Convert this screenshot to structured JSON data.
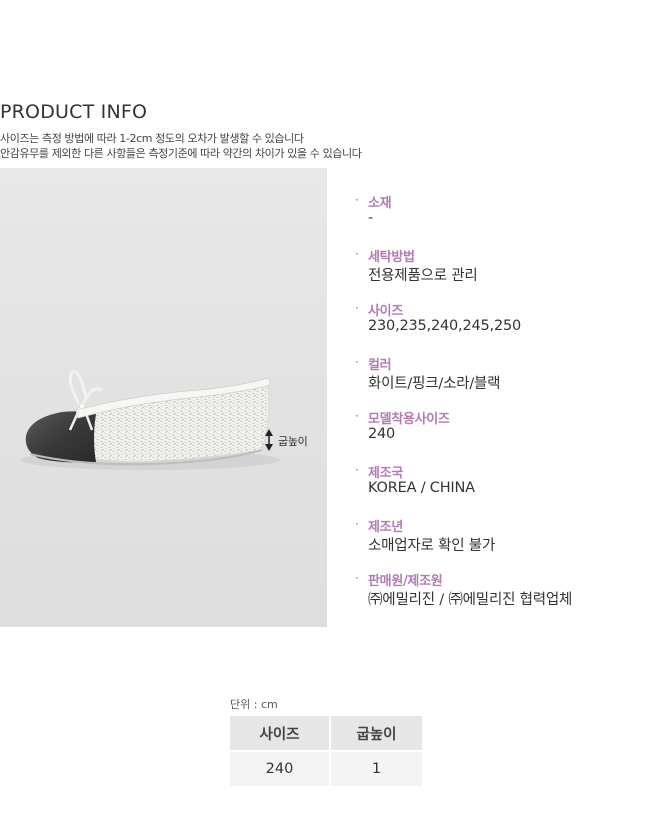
{
  "section": {
    "title": "PRODUCT INFO",
    "notes": [
      "사이즈는 측정 방법에 따라 1-2cm 정도의 오차가 발생할 수 있습니다",
      "안감유무를 제외한 다른 사항들은 측정기준에 따라 약간의 차이가 있을 수 있습니다"
    ]
  },
  "photo": {
    "heel_label": "굽높이",
    "colors": {
      "background": "#e3e3e3",
      "toe_cap": "#3c3c3c",
      "tweed_base": "#f3f1ee",
      "trim": "#f7f6f2"
    }
  },
  "info": {
    "bullet": "·",
    "accent_color": "#b27bb4",
    "items": [
      {
        "label": "소재",
        "value": "-"
      },
      {
        "label": "세탁방법",
        "value": "전용제품으로 관리"
      },
      {
        "label": "사이즈",
        "value": "230,235,240,245,250"
      },
      {
        "label": "컬러",
        "value": "화이트/핑크/소라/블랙"
      },
      {
        "label": "모델착용사이즈",
        "value": "240"
      },
      {
        "label": "제조국",
        "value": "KOREA / CHINA"
      },
      {
        "label": "제조년",
        "value": "소매업자로 확인 불가"
      },
      {
        "label": "판매원/제조원",
        "value": "㈜에밀리진 / ㈜에밀리진 협력업체"
      }
    ]
  },
  "size_table": {
    "unit": "단위 : cm",
    "headers": [
      "사이즈",
      "굽높이"
    ],
    "rows": [
      [
        "240",
        "1"
      ]
    ]
  }
}
